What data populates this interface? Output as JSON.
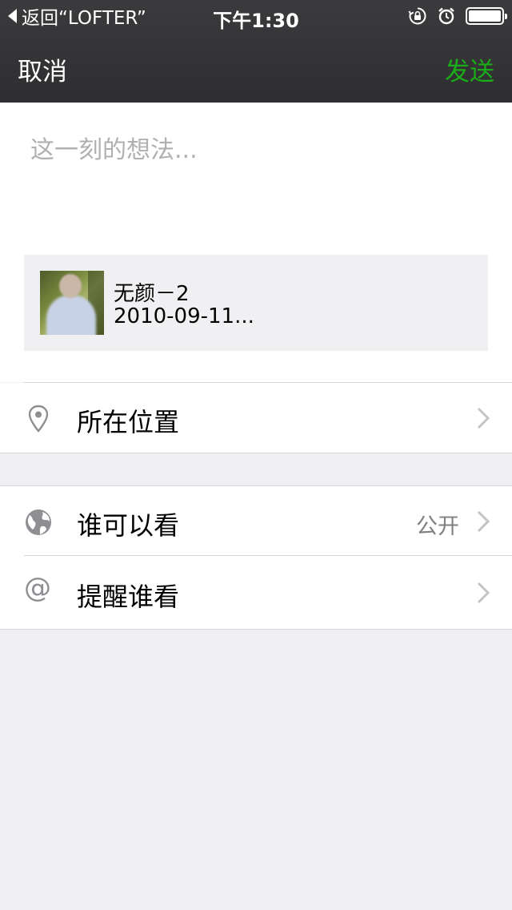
{
  "status_bar": {
    "back_app_label": "返回“LOFTER”",
    "time": "下午1:30",
    "icons": [
      "rotation-lock-icon",
      "alarm-icon",
      "battery-icon"
    ],
    "battery_level": 1.0
  },
  "nav": {
    "cancel_label": "取消",
    "send_label": "发送",
    "send_color": "#1aad19"
  },
  "compose": {
    "placeholder": "这一刻的想法...",
    "value": ""
  },
  "shared_item": {
    "title": "无颜－2",
    "subtitle": "2010-09-11..."
  },
  "options": {
    "location": {
      "label": "所在位置",
      "icon": "location-pin-icon"
    },
    "visibility": {
      "label": "谁可以看",
      "value": "公开",
      "icon": "globe-icon"
    },
    "mention": {
      "label": "提醒谁看",
      "icon": "at-sign-icon",
      "glyph": "@"
    }
  }
}
